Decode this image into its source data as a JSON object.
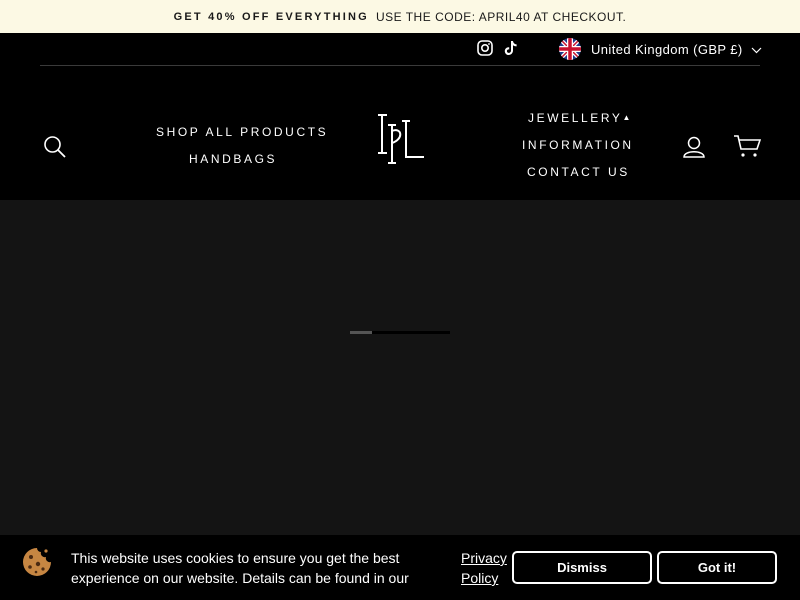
{
  "announcement": {
    "strong": "GET  40% OFF EVERYTHING",
    "text": "USE THE CODE: APRIL40 AT CHECKOUT."
  },
  "utility": {
    "social_icons": [
      "instagram-icon",
      "tiktok-icon"
    ],
    "country": "United Kingdom (GBP £)"
  },
  "nav": {
    "left": [
      "SHOP ALL PRODUCTS",
      "HANDBAGS"
    ],
    "right": [
      "JEWELLERY",
      "INFORMATION",
      "CONTACT US"
    ],
    "icons": [
      "search-icon",
      "account-icon",
      "cart-icon"
    ]
  },
  "loader": {
    "progress": 0.22
  },
  "cookie": {
    "message": "This website uses cookies to ensure you get the best experience on our website. Details can be found in our",
    "policy_link": "Privacy Policy",
    "dismiss": "Dismiss",
    "accept": "Got it!"
  },
  "colors": {
    "announcement_bg": "#fcf9e4",
    "header_bg": "#000000",
    "page_bg": "#141414",
    "text": "#ffffff"
  }
}
